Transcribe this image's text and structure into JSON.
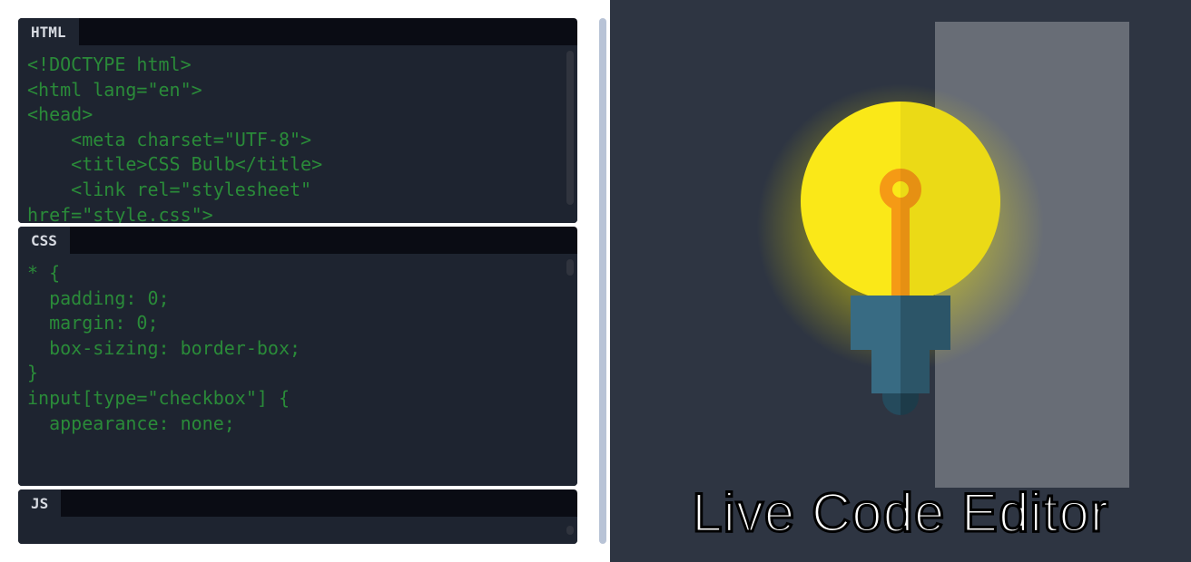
{
  "editor": {
    "html": {
      "tab": "HTML",
      "code": "<!DOCTYPE html>\n<html lang=\"en\">\n<head>\n    <meta charset=\"UTF-8\">\n    <title>CSS Bulb</title>\n    <link rel=\"stylesheet\"\nhref=\"style.css\">"
    },
    "css": {
      "tab": "CSS",
      "code": "* {\n  padding: 0;\n  margin: 0;\n  box-sizing: border-box;\n}\ninput[type=\"checkbox\"] {\n  appearance: none;\n"
    },
    "js": {
      "tab": "JS",
      "code": ""
    }
  },
  "preview": {
    "title": "Live Code Editor"
  }
}
